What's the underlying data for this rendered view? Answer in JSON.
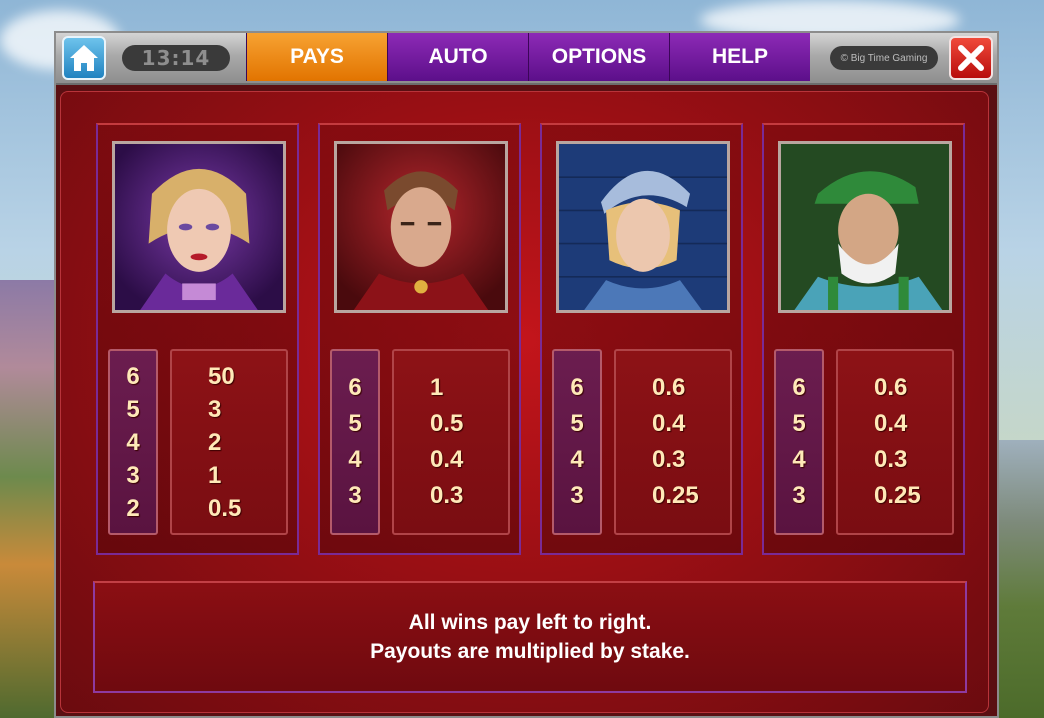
{
  "topbar": {
    "clock": "13:14",
    "tabs": [
      "PAYS",
      "AUTO",
      "OPTIONS",
      "HELP"
    ],
    "active_tab": "PAYS",
    "brand": "© Big Time Gaming",
    "icons": {
      "home": "home-icon",
      "close": "close-x-icon"
    }
  },
  "paytable": [
    {
      "symbol": "sorceress",
      "counts": [
        "6",
        "5",
        "4",
        "3",
        "2"
      ],
      "payouts": [
        "50",
        "3",
        "2",
        "1",
        "0.5"
      ]
    },
    {
      "symbol": "nobleman",
      "counts": [
        "6",
        "5",
        "4",
        "3"
      ],
      "payouts": [
        "1",
        "0.5",
        "0.4",
        "0.3"
      ]
    },
    {
      "symbol": "maid",
      "counts": [
        "6",
        "5",
        "4",
        "3"
      ],
      "payouts": [
        "0.6",
        "0.4",
        "0.3",
        "0.25"
      ]
    },
    {
      "symbol": "old-man",
      "counts": [
        "6",
        "5",
        "4",
        "3"
      ],
      "payouts": [
        "0.6",
        "0.4",
        "0.3",
        "0.25"
      ]
    }
  ],
  "info": {
    "line1": "All wins pay left to right.",
    "line2": "Payouts are multiplied by stake."
  },
  "colors": {
    "active_tab": "#f08a1a",
    "tab": "#6e1a9c",
    "panel": "#b0131a",
    "payout_text": "#ffe9b8"
  }
}
